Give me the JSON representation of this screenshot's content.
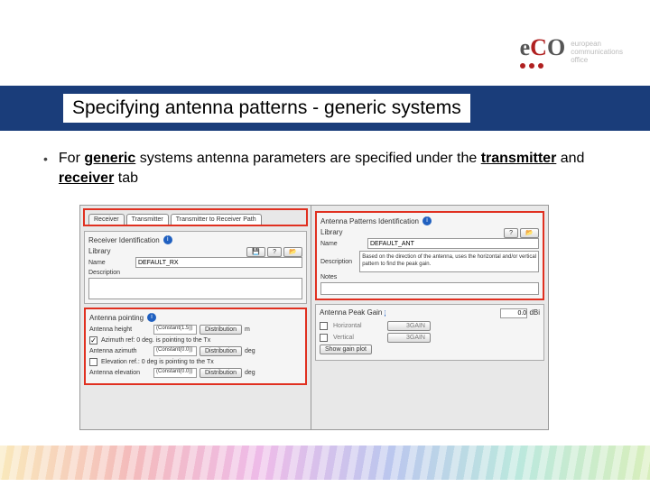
{
  "logo": {
    "brand": "eCO",
    "tagline1": "european",
    "tagline2": "communications",
    "tagline3": "office"
  },
  "title": "Specifying antenna patterns - generic systems",
  "bullet": {
    "pre": "For ",
    "generic": "generic",
    "mid": " systems antenna parameters are specified under the ",
    "tx": "transmitter",
    "and": " and ",
    "rx": "receiver",
    "post": " tab"
  },
  "tabs": {
    "receiver": "Receiver",
    "transmitter": "Transmitter",
    "path": "Transmitter to Receiver Path"
  },
  "left": {
    "id_title": "Receiver Identification",
    "library": "Library",
    "name_lbl": "Name",
    "name_val": "DEFAULT_RX",
    "desc_lbl": "Description",
    "pointing_title": "Antenna pointing",
    "height_lbl": "Antenna height",
    "height_val": "(Constant(1.5))",
    "dist_btn": "Distribution",
    "unit_m": "m",
    "az_note": "Azimuth ref: 0 deg. is pointing to the Tx",
    "az_lbl": "Antenna azimuth",
    "az_val": "(Constant(0.0))",
    "unit_deg": "deg",
    "el_note": "Elevation ref.: 0 deg is pointing to the Tx",
    "el_lbl": "Antenna elevation",
    "el_val": "(Constant(0.0))"
  },
  "right": {
    "id_title": "Antenna Patterns Identification",
    "library": "Library",
    "name_lbl": "Name",
    "name_val": "DEFAULT_ANT",
    "desc_lbl": "Description",
    "desc_val": "Based on the direction of the antenna, uses the horizontal and/or vertical pattern to find the peak gain.",
    "notes_lbl": "Notes",
    "gain_title": "Antenna Peak Gain",
    "gain_val": "0.0",
    "gain_unit": "dBi",
    "horiz": "Horizontal",
    "vert": "Vertical",
    "btn_val": "3GAIN",
    "show": "Show gain plot"
  }
}
